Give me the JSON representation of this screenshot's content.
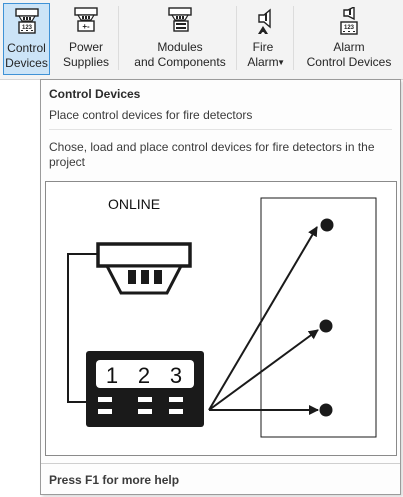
{
  "ribbon": {
    "buttons": [
      {
        "id": "control-devices",
        "line1": "Control",
        "line2": "Devices",
        "icon": "control-device-icon",
        "active": true
      },
      {
        "id": "power-supplies",
        "line1": "Power",
        "line2": "Supplies",
        "icon": "power-supply-icon",
        "active": false
      },
      {
        "id": "modules",
        "line1": "Modules",
        "line2": "and Components",
        "icon": "module-icon",
        "active": false
      },
      {
        "id": "fire-alarm",
        "line1": "Fire",
        "line2": "Alarm",
        "icon": "fire-alarm-icon",
        "active": false,
        "dropdown": true
      },
      {
        "id": "alarm-control",
        "line1": "Alarm",
        "line2": "Control Devices",
        "icon": "alarm-control-icon",
        "active": false
      }
    ]
  },
  "tooltip": {
    "title": "Control Devices",
    "subtitle": "Place control devices for fire detectors",
    "description": "Chose, load and place control devices for fire detectors in the project",
    "figure": {
      "status_label": "ONLINE",
      "display_digits": [
        "1",
        "2",
        "3"
      ]
    },
    "help": "Press F1 for more help"
  },
  "colors": {
    "ribbon_bg": "#f3f3f3",
    "active_bg": "#cce4f7",
    "active_border": "#3f92d6",
    "figure_ink": "#1a1a1a"
  }
}
